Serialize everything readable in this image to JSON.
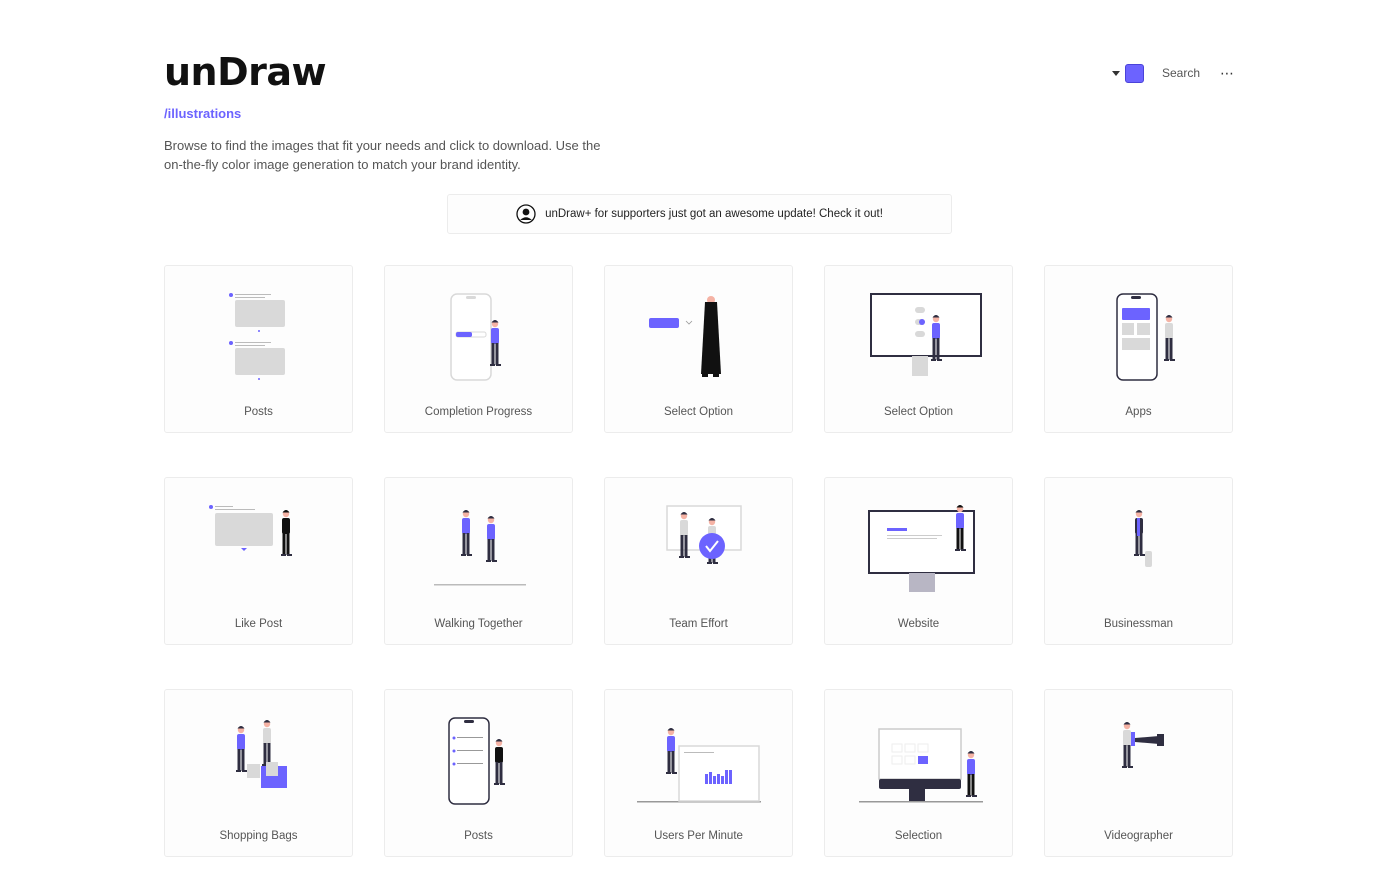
{
  "header": {
    "logo": "unDraw",
    "subnav_link": "/illustrations",
    "description": "Browse to find the images that fit your needs and click to download. Use the on-the-fly color image generation to match your brand identity."
  },
  "toolbar": {
    "color_picker_icon": "caret-down-icon",
    "accent_color": "#6c63ff",
    "search_label": "Search",
    "more_label": "⋯"
  },
  "banner": {
    "icon": "user-avatar-icon",
    "text": "unDraw+ for supporters just got an awesome update! Check it out!"
  },
  "colors": {
    "accent": "#6c63ff",
    "dark": "#2f2e41",
    "gray": "#d9d9d9"
  },
  "illustrations": [
    {
      "title": "Posts",
      "kind": "posts"
    },
    {
      "title": "Completion Progress",
      "kind": "progress"
    },
    {
      "title": "Select Option",
      "kind": "select1"
    },
    {
      "title": "Select Option",
      "kind": "select2"
    },
    {
      "title": "Apps",
      "kind": "apps"
    },
    {
      "title": "Like Post",
      "kind": "like"
    },
    {
      "title": "Walking Together",
      "kind": "walking"
    },
    {
      "title": "Team Effort",
      "kind": "team"
    },
    {
      "title": "Website",
      "kind": "website"
    },
    {
      "title": "Businessman",
      "kind": "businessman"
    },
    {
      "title": "Shopping Bags",
      "kind": "shopping"
    },
    {
      "title": "Posts",
      "kind": "phoneposts"
    },
    {
      "title": "Users Per Minute",
      "kind": "users"
    },
    {
      "title": "Selection",
      "kind": "selection"
    },
    {
      "title": "Videographer",
      "kind": "videographer"
    }
  ]
}
